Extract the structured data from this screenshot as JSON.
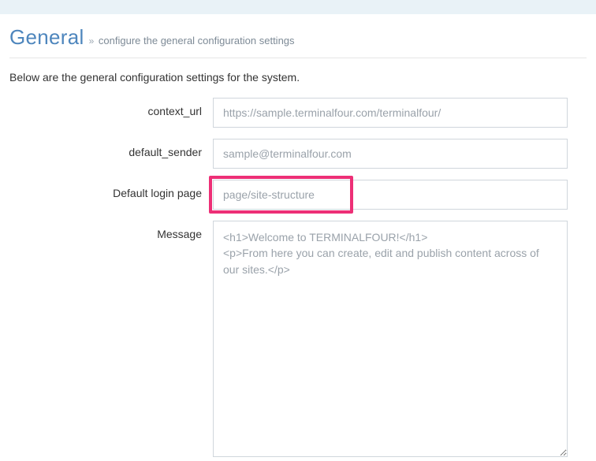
{
  "header": {
    "title": "General",
    "separator": "»",
    "subtitle": "configure the general configuration settings"
  },
  "intro": "Below are the general configuration settings for the system.",
  "form": {
    "context_url": {
      "label": "context_url",
      "value": "https://sample.terminalfour.com/terminalfour/"
    },
    "default_sender": {
      "label": "default_sender",
      "value": "sample@terminalfour.com"
    },
    "default_login_page": {
      "label": "Default login page",
      "value": "page/site-structure"
    },
    "message": {
      "label": "Message",
      "value": "<h1>Welcome to TERMINALFOUR!</h1>\n<p>From here you can create, edit and publish content across of our sites.</p>"
    }
  }
}
